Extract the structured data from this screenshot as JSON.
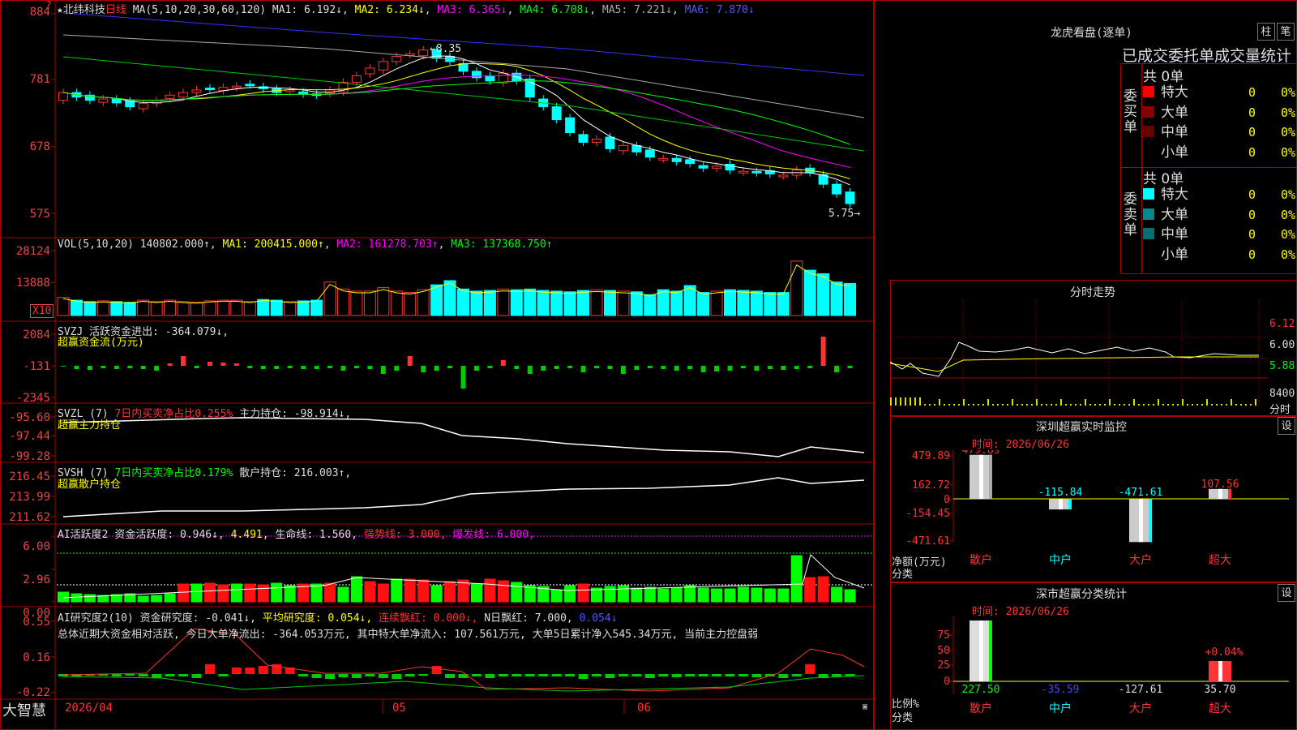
{
  "main": {
    "star_icon": "★",
    "stock_name": "北纬科技",
    "period": "日线",
    "ma_label": "MA(5,10,20,30,60,120)",
    "ma1": "MA1: 6.192↓",
    "ma2": "MA2: 6.234↓",
    "ma3": "MA3: 6.365↓",
    "ma4": "MA4: 6.708↓",
    "ma5": "MA5: 7.221↓",
    "ma6": "MA6: 7.870↓",
    "y_labels": [
      "884",
      "781",
      "678",
      "575"
    ],
    "high_label": "8.35",
    "low_label": "5.75",
    "question": "?"
  },
  "vol": {
    "label": "VOL(5,10,20)",
    "value": "140802.000↑",
    "ma1": "MA1: 200415.000↑",
    "ma2": "MA2: 161278.703↑",
    "ma3": "MA3: 137368.750↑",
    "y_labels": [
      "28124",
      "13888"
    ],
    "unit": "X10"
  },
  "svzj": {
    "label": "SVZJ",
    "value": "活跃资金进出: -364.079↓,",
    "title": "超赢资金流(万元)",
    "y_labels": [
      "2084",
      "-131",
      "-2345"
    ]
  },
  "svzl": {
    "label": "SVZL (7)",
    "ratio": "7日内买卖净占比0.255%",
    "value": "主力持仓: -98.914↓,",
    "title": "超赢主力持仓",
    "y_labels": [
      "-95.60",
      "-97.44",
      "-99.28"
    ]
  },
  "svsh": {
    "label": "SVSH (7)",
    "ratio": "7日内买卖净占比0.179%",
    "value": "散户持仓: 216.003↑,",
    "title": "超赢散户持仓",
    "y_labels": [
      "216.45",
      "213.99",
      "211.62"
    ]
  },
  "ai_active": {
    "label": "AI活跃度2",
    "v1": "资金活跃度: 0.946↓,",
    "v2": "4.491,",
    "v3": "生命线: 1.560,",
    "v4": "强势线: 3.000,",
    "v5": "爆发线: 6.000,",
    "y_labels": [
      "6.00",
      "2.96",
      "0.00"
    ]
  },
  "ai_research": {
    "label": "AI研究度2(10)",
    "v1": "资金研究度: -0.041↓,",
    "v2": "平均研究度: 0.054↓,",
    "v3": "连续飘红: 0.000↓,",
    "v4": "N日飘红: 7.000,",
    "v5": "0.054↓",
    "summary": "总体近期大资金相对活跃, 今日大单净流出: -364.053万元, 其中特大单净流入: 107.561万元, 大单5日累计净入545.34万元, 当前主力控盘弱",
    "y_labels": [
      "0.55",
      "0.16",
      "-0.22"
    ]
  },
  "footer": {
    "brand": "大智慧",
    "date_start": "2026/04",
    "month_05": "05",
    "month_06": "06"
  },
  "lhk": {
    "title": "龙虎看盘(逐单)",
    "btn1": "柱",
    "btn2": "笔",
    "header": "已成交委托单成交量统计",
    "buy_total": "共 0单",
    "buy_side": "委买单",
    "sell_total": "共 0单",
    "sell_side": "委卖单",
    "buy_rows": [
      {
        "label": "特大",
        "color": "#ff0000",
        "count": "0",
        "pct": "0%"
      },
      {
        "label": "大单",
        "color": "#8b0000",
        "count": "0",
        "pct": "0%"
      },
      {
        "label": "中单",
        "color": "#6b0000",
        "count": "0",
        "pct": "0%"
      },
      {
        "label": "小单",
        "color": "#000000",
        "count": "0",
        "pct": "0%"
      }
    ],
    "sell_rows": [
      {
        "label": "特大",
        "color": "#00ffff",
        "count": "0",
        "pct": "0%"
      },
      {
        "label": "大单",
        "color": "#008b8b",
        "count": "0",
        "pct": "0%"
      },
      {
        "label": "中单",
        "color": "#007070",
        "count": "0",
        "pct": "0%"
      },
      {
        "label": "小单",
        "color": "#000000",
        "count": "0",
        "pct": "0%"
      }
    ]
  },
  "intraday": {
    "title": "分时走势",
    "y_labels": [
      "6.12",
      "6.00",
      "5.88"
    ],
    "vol_label": "8400",
    "time_label": "分时"
  },
  "sz_monitor": {
    "title": "深圳超赢实时监控",
    "btn": "设",
    "time": "时间: 2026/06/26",
    "y_labels": [
      "479.89",
      "162.72",
      "0",
      "-154.45",
      "-471.61"
    ],
    "y_title": "净额(万元)",
    "x_title": "分类",
    "bars": [
      {
        "name": "散户",
        "value": 479.89,
        "label": "479.89",
        "label_color": "#f33"
      },
      {
        "name": "中户",
        "value": -115.84,
        "label": "-115.84",
        "label_color": "#0ff"
      },
      {
        "name": "大户",
        "value": -471.61,
        "label": "-471.61",
        "label_color": "#0ff"
      },
      {
        "name": "超大",
        "value": 107.56,
        "label": "107.56",
        "label_color": "#f33"
      }
    ]
  },
  "sz_class": {
    "title": "深市超赢分类统计",
    "btn": "设",
    "time": "时间: 2026/06/26",
    "y_labels": [
      "75",
      "50",
      "25",
      "0"
    ],
    "y_title": "比例%",
    "x_title": "分类",
    "pct_label": "+0.04%",
    "bars": [
      {
        "name": "散户",
        "value": 227.5,
        "label": "227.50",
        "label_color": "#0f0"
      },
      {
        "name": "中户",
        "value": -35.59,
        "label": "-35.59",
        "label_color": "#44f"
      },
      {
        "name": "大户",
        "value": -127.61,
        "label": "-127.61",
        "label_color": "#ddd"
      },
      {
        "name": "超大",
        "value": 35.7,
        "label": "35.70",
        "label_color": "#ddd"
      }
    ]
  }
}
